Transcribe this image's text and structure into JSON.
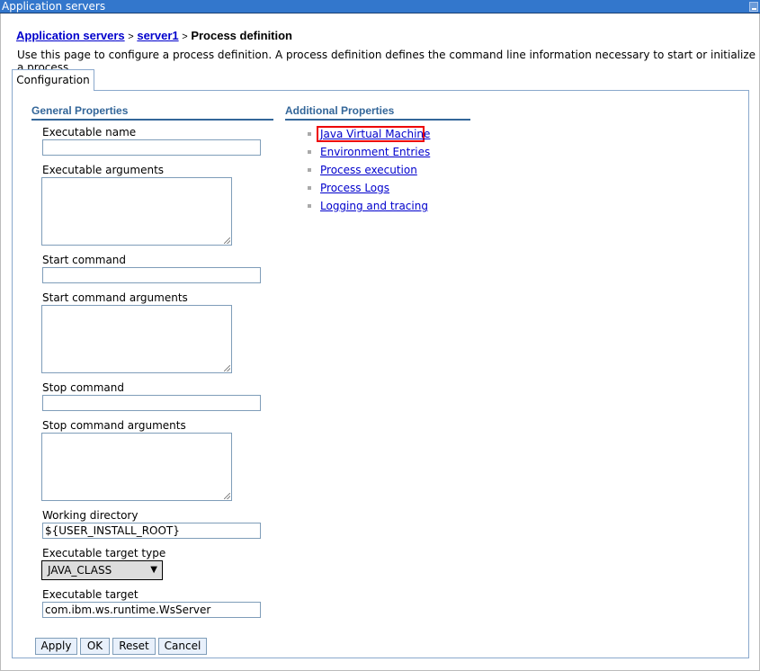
{
  "window": {
    "title": "Application servers"
  },
  "breadcrumb": {
    "items": [
      "Application servers",
      "server1"
    ],
    "separator": ">",
    "current": "Process definition"
  },
  "description": "Use this page to configure a process definition. A process definition defines the command line information necessary to start or initialize a process.",
  "tabs": [
    {
      "label": "Configuration",
      "active": true
    }
  ],
  "general": {
    "title": "General Properties",
    "executable_name": {
      "label": "Executable name",
      "value": ""
    },
    "executable_arguments": {
      "label": "Executable arguments",
      "value": ""
    },
    "start_command": {
      "label": "Start command",
      "value": ""
    },
    "start_command_arguments": {
      "label": "Start command arguments",
      "value": ""
    },
    "stop_command": {
      "label": "Stop command",
      "value": ""
    },
    "stop_command_arguments": {
      "label": "Stop command arguments",
      "value": ""
    },
    "working_directory": {
      "label": "Working directory",
      "value": "${USER_INSTALL_ROOT}"
    },
    "executable_target_type": {
      "label": "Executable target type",
      "value": "JAVA_CLASS"
    },
    "executable_target": {
      "label": "Executable target",
      "value": "com.ibm.ws.runtime.WsServer"
    }
  },
  "additional": {
    "title": "Additional Properties",
    "links": [
      "Java Virtual Machine",
      "Environment Entries",
      "Process execution",
      "Process Logs",
      "Logging and tracing"
    ],
    "highlighted": "Java Virtual Machine",
    "highlight_color": "#ee0000"
  },
  "buttons": {
    "apply": "Apply",
    "ok": "OK",
    "reset": "Reset",
    "cancel": "Cancel"
  }
}
